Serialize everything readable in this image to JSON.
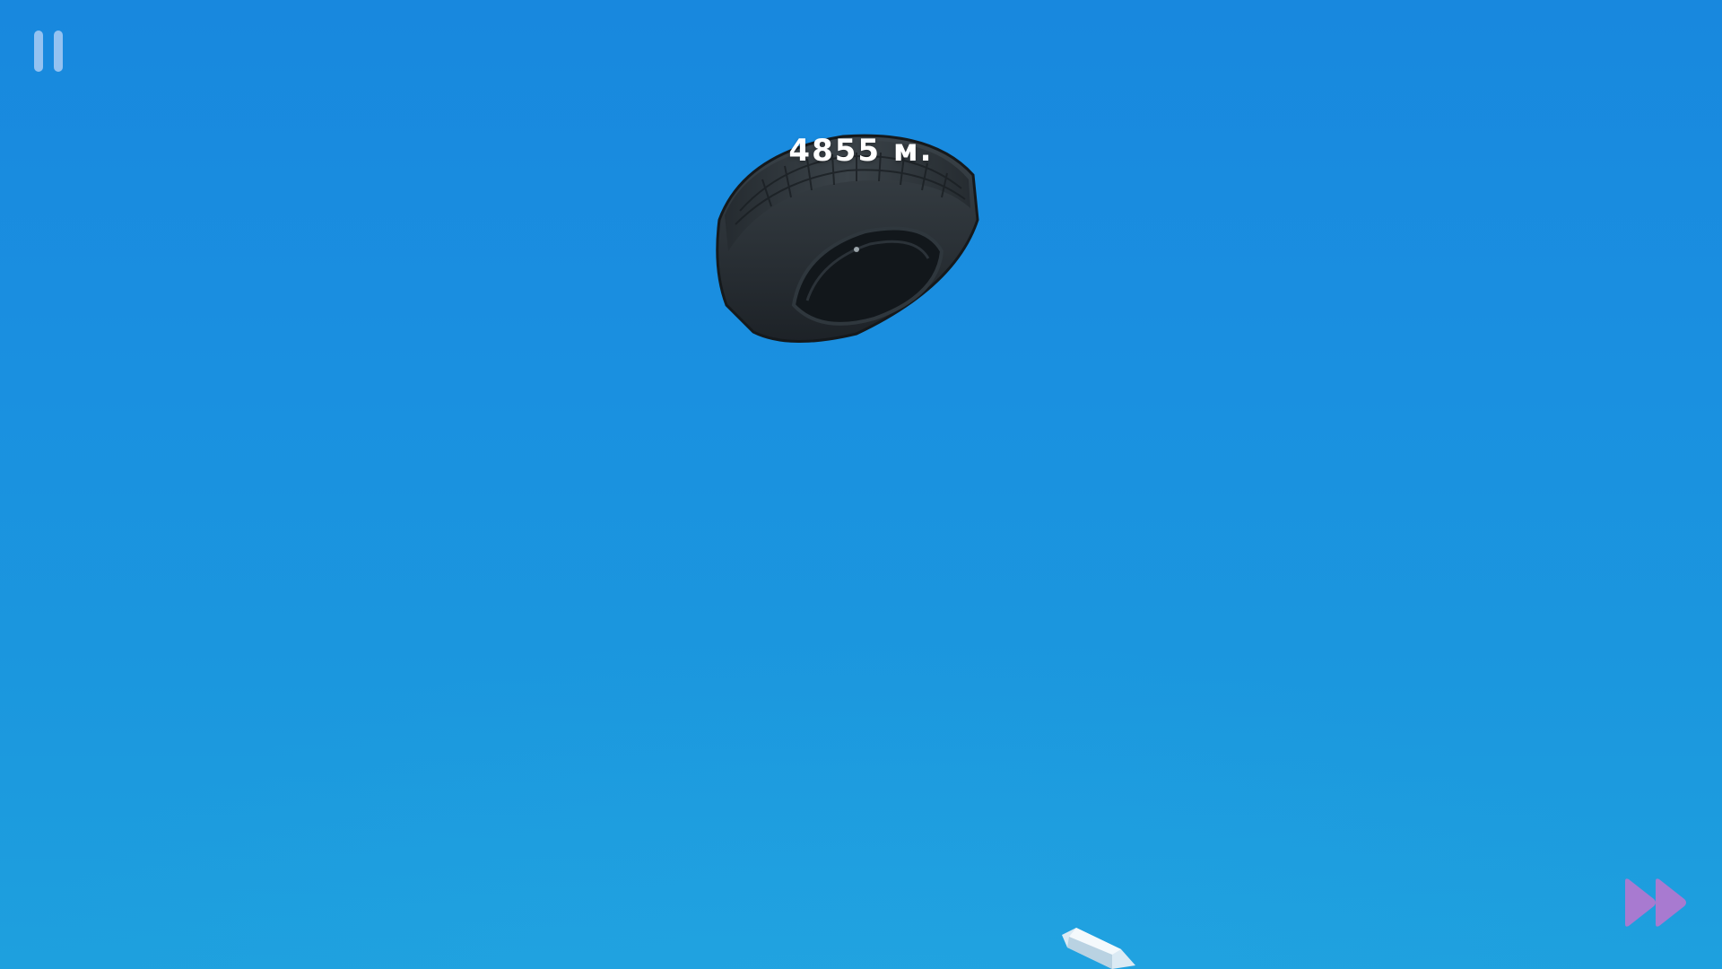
{
  "hud": {
    "distance_text": "4855 м.",
    "pause_icon": "pause-icon",
    "fast_forward_icon": "fast-forward-icon"
  },
  "scene": {
    "object": "tire",
    "sky_color": "#1a8fe0"
  },
  "colors": {
    "pause_icon": "#aacdf5",
    "fast_forward_icon": "#a87ad0",
    "distance_text": "#ffffff"
  }
}
